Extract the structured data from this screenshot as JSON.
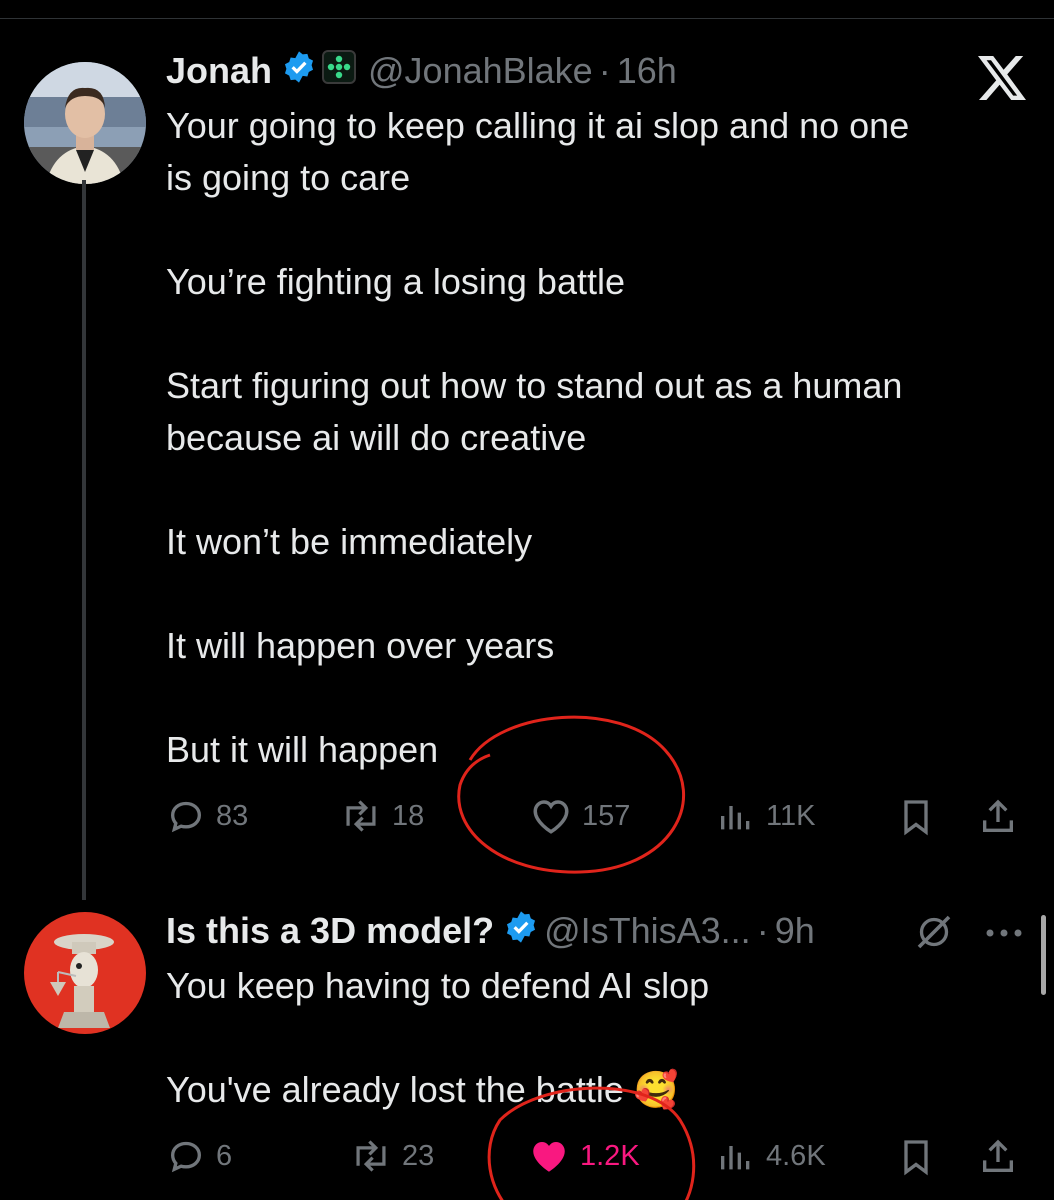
{
  "post1": {
    "name": "Jonah",
    "handle": "@JonahBlake",
    "separator": "·",
    "time": "16h",
    "text": "Your going to keep calling it ai slop and no one\nis going to care\n\nYou’re fighting a losing battle\n\nStart figuring out how to stand out as a human\nbecause ai will do creative\n\nIt won’t be immediately\n\nIt will happen over years\n\nBut it will happen",
    "replies": "83",
    "reposts": "18",
    "likes": "157",
    "views": "11K",
    "liked": false,
    "brand_icon": "x-logo-icon"
  },
  "post2": {
    "name": "Is this a 3D model?",
    "handle": "@IsThisA3...",
    "separator": "·",
    "time": "9h",
    "text": "You keep having to defend AI slop\n\nYou've already lost the battle",
    "emoji": "🥰",
    "replies": "6",
    "reposts": "23",
    "likes": "1.2K",
    "views": "4.6K",
    "liked": true
  },
  "colors": {
    "background": "#000000",
    "text": "#e7e9ea",
    "muted": "#71767b",
    "verified": "#1d9bf0",
    "like_active": "#f91880",
    "annotation_red": "#e0241b"
  }
}
